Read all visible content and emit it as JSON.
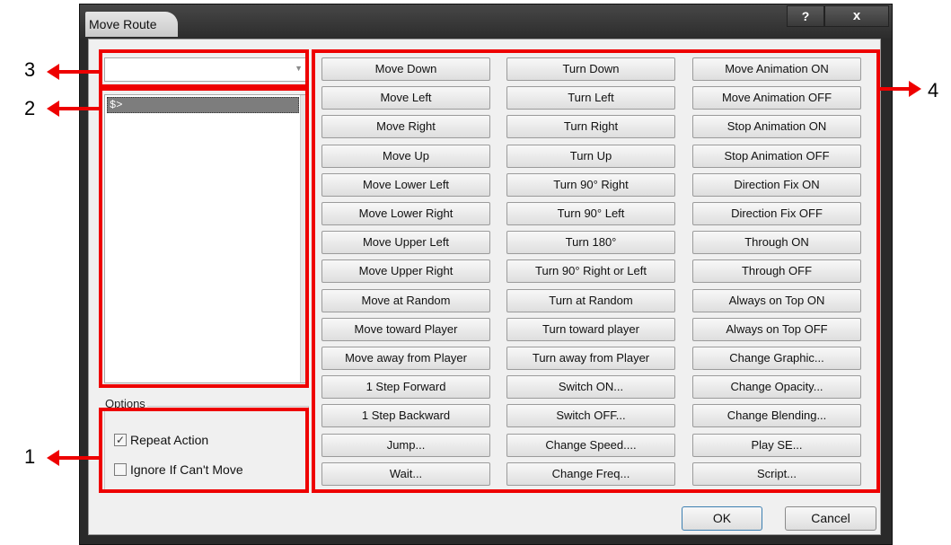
{
  "window": {
    "title": "Move Route",
    "help_label": "?",
    "close_label": "x"
  },
  "route_select": {
    "value": "",
    "arrow": "chevron-down-icon"
  },
  "route_list": {
    "items": [
      "$>"
    ]
  },
  "options": {
    "legend": "Options",
    "repeat_action": {
      "label": "Repeat Action",
      "checked": true
    },
    "ignore_if_cant_move": {
      "label": "Ignore If Can't Move",
      "checked": false
    }
  },
  "commands": {
    "col1": [
      "Move Down",
      "Move Left",
      "Move Right",
      "Move Up",
      "Move Lower Left",
      "Move Lower Right",
      "Move Upper Left",
      "Move Upper Right",
      "Move at Random",
      "Move toward Player",
      "Move away from Player",
      "1 Step Forward",
      "1 Step Backward",
      "Jump...",
      "Wait..."
    ],
    "col2": [
      "Turn Down",
      "Turn Left",
      "Turn Right",
      "Turn Up",
      "Turn 90° Right",
      "Turn 90° Left",
      "Turn 180°",
      "Turn 90° Right or Left",
      "Turn at Random",
      "Turn toward player",
      "Turn away from Player",
      "Switch ON...",
      "Switch OFF...",
      "Change Speed....",
      "Change Freq..."
    ],
    "col3": [
      "Move Animation ON",
      "Move Animation OFF",
      "Stop Animation ON",
      "Stop Animation OFF",
      "Direction Fix ON",
      "Direction Fix OFF",
      "Through ON",
      "Through OFF",
      "Always on Top ON",
      "Always on Top OFF",
      "Change Graphic...",
      "Change Opacity...",
      "Change Blending...",
      "Play SE...",
      "Script..."
    ]
  },
  "dialog_buttons": {
    "ok": "OK",
    "cancel": "Cancel"
  },
  "callouts": {
    "one": "1",
    "two": "2",
    "three": "3",
    "four": "4"
  },
  "colors": {
    "callout": "#ee0000",
    "titlebar": "#2c2c2c",
    "client": "#f0f0f0"
  }
}
